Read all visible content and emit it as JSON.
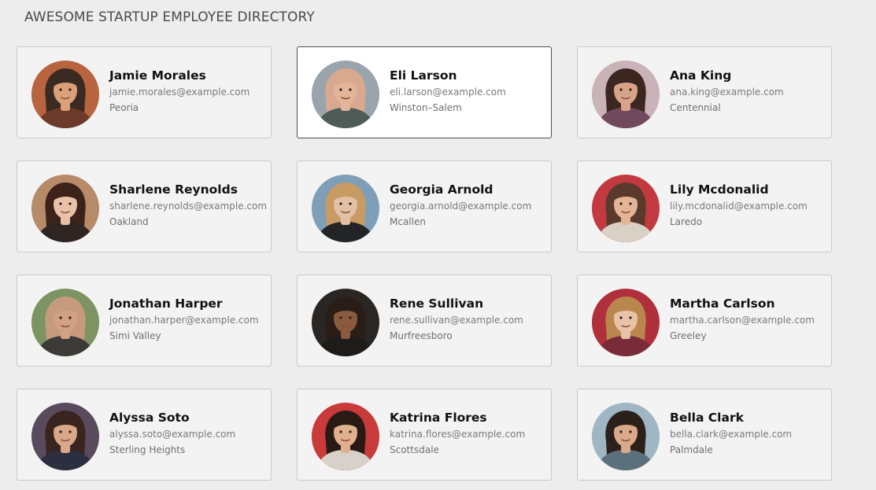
{
  "header": {
    "title": "AWESOME STARTUP EMPLOYEE DIRECTORY"
  },
  "selected_index": 1,
  "employees": [
    {
      "name": "Jamie Morales",
      "email": "jamie.morales@example.com",
      "city": "Peoria",
      "avatar": {
        "bg": "#b8643f",
        "skin": "#d9a07a",
        "hair": "#3a2a22",
        "clothes": "#6b3a2a"
      }
    },
    {
      "name": "Eli Larson",
      "email": "eli.larson@example.com",
      "city": "Winston–Salem",
      "avatar": {
        "bg": "#9aa4ad",
        "skin": "#e3b39a",
        "hair": "#d9a98f",
        "clothes": "#4f5b56"
      }
    },
    {
      "name": "Ana King",
      "email": "ana.king@example.com",
      "city": "Centennial",
      "avatar": {
        "bg": "#c9b3b8",
        "skin": "#d7a48a",
        "hair": "#3b2620",
        "clothes": "#6f4a5c"
      }
    },
    {
      "name": "Sharlene Reynolds",
      "email": "sharlene.reynolds@example.com",
      "city": "Oakland",
      "avatar": {
        "bg": "#b78a6a",
        "skin": "#e7c1a8",
        "hair": "#3c2218",
        "clothes": "#2e2522"
      }
    },
    {
      "name": "Georgia Arnold",
      "email": "georgia.arnold@example.com",
      "city": "Mcallen",
      "avatar": {
        "bg": "#7f9fb8",
        "skin": "#e2c0a4",
        "hair": "#c79b63",
        "clothes": "#222426"
      }
    },
    {
      "name": "Lily Mcdonalid",
      "email": "lily.mcdonalid@example.com",
      "city": "Laredo",
      "avatar": {
        "bg": "#c23a3f",
        "skin": "#e3b496",
        "hair": "#5a3a2c",
        "clothes": "#d9d0c6"
      }
    },
    {
      "name": "Jonathan Harper",
      "email": "jonathan.harper@example.com",
      "city": "Simi Valley",
      "avatar": {
        "bg": "#7c9462",
        "skin": "#d0a283",
        "hair": "#c69a7c",
        "clothes": "#3b3a37"
      }
    },
    {
      "name": "Rene Sullivan",
      "email": "rene.sullivan@example.com",
      "city": "Murfreesboro",
      "avatar": {
        "bg": "#2a2624",
        "skin": "#8a5a3f",
        "hair": "#2a1d17",
        "clothes": "#1e1c1b"
      }
    },
    {
      "name": "Martha Carlson",
      "email": "martha.carlson@example.com",
      "city": "Greeley",
      "avatar": {
        "bg": "#b02f3c",
        "skin": "#e8c3a8",
        "hair": "#b9864e",
        "clothes": "#7a2b3a"
      }
    },
    {
      "name": "Alyssa Soto",
      "email": "alyssa.soto@example.com",
      "city": "Sterling Heights",
      "avatar": {
        "bg": "#5a4a5d",
        "skin": "#d9a789",
        "hair": "#3a2420",
        "clothes": "#2c2f3f"
      }
    },
    {
      "name": "Katrina Flores",
      "email": "katrina.flores@example.com",
      "city": "Scottsdale",
      "avatar": {
        "bg": "#c93a3a",
        "skin": "#e1b08d",
        "hair": "#2a1a16",
        "clothes": "#d8d1c9"
      }
    },
    {
      "name": "Bella Clark",
      "email": "bella.clark@example.com",
      "city": "Palmdale",
      "avatar": {
        "bg": "#9fb7c4",
        "skin": "#d9a98a",
        "hair": "#2c201b",
        "clothes": "#5c6f7d"
      }
    }
  ]
}
